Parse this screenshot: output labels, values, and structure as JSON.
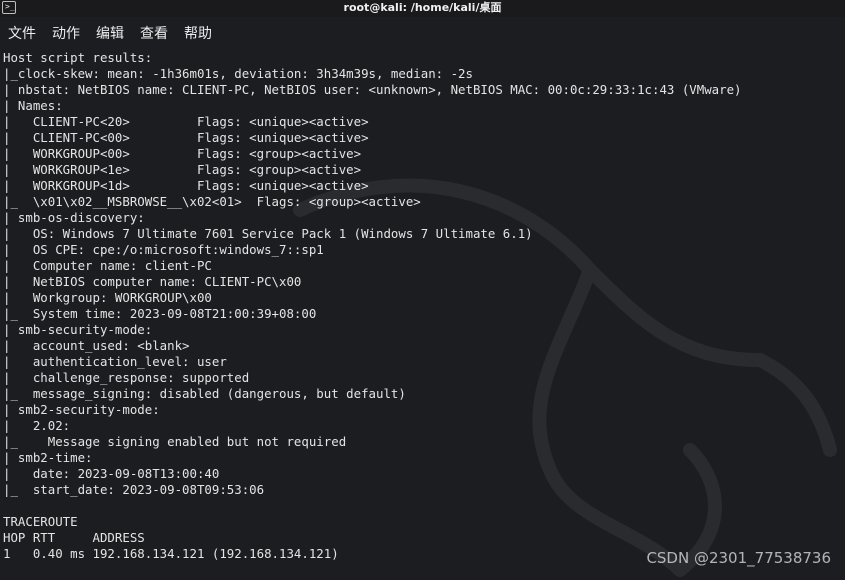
{
  "window": {
    "title": "root@kali: /home/kali/桌面"
  },
  "menu": [
    "文件",
    "动作",
    "编辑",
    "查看",
    "帮助"
  ],
  "terminal_lines": [
    "Host script results:",
    "|_clock-skew: mean: -1h36m01s, deviation: 3h34m39s, median: -2s",
    "| nbstat: NetBIOS name: CLIENT-PC, NetBIOS user: <unknown>, NetBIOS MAC: 00:0c:29:33:1c:43 (VMware)",
    "| Names:",
    "|   CLIENT-PC<20>         Flags: <unique><active>",
    "|   CLIENT-PC<00>         Flags: <unique><active>",
    "|   WORKGROUP<00>         Flags: <group><active>",
    "|   WORKGROUP<1e>         Flags: <group><active>",
    "|   WORKGROUP<1d>         Flags: <unique><active>",
    "|_  \\x01\\x02__MSBROWSE__\\x02<01>  Flags: <group><active>",
    "| smb-os-discovery:",
    "|   OS: Windows 7 Ultimate 7601 Service Pack 1 (Windows 7 Ultimate 6.1)",
    "|   OS CPE: cpe:/o:microsoft:windows_7::sp1",
    "|   Computer name: client-PC",
    "|   NetBIOS computer name: CLIENT-PC\\x00",
    "|   Workgroup: WORKGROUP\\x00",
    "|_  System time: 2023-09-08T21:00:39+08:00",
    "| smb-security-mode:",
    "|   account_used: <blank>",
    "|   authentication_level: user",
    "|   challenge_response: supported",
    "|_  message_signing: disabled (dangerous, but default)",
    "| smb2-security-mode:",
    "|   2.02:",
    "|_    Message signing enabled but not required",
    "| smb2-time:",
    "|   date: 2023-09-08T13:00:40",
    "|_  start_date: 2023-09-08T09:53:06",
    "",
    "TRACEROUTE",
    "HOP RTT     ADDRESS",
    "1   0.40 ms 192.168.134.121 (192.168.134.121)"
  ],
  "watermark_text": "CSDN @2301_77538736",
  "colors": {
    "background": "#1c1d20",
    "text": "#e4e4e4"
  },
  "icons": {
    "app_icon": "terminal-icon",
    "background": "kali-dragon-logo"
  }
}
